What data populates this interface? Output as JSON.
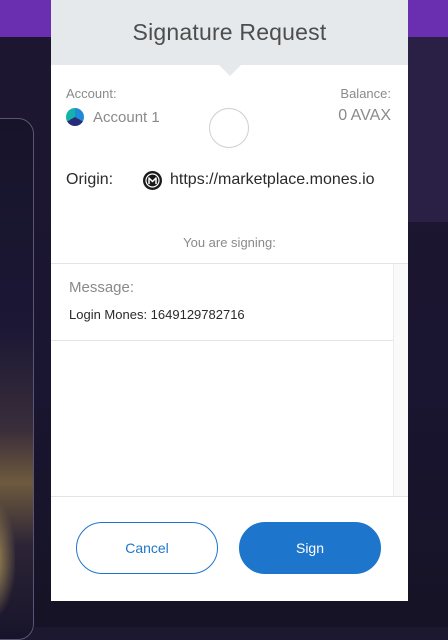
{
  "header": {
    "title": "Signature Request"
  },
  "account": {
    "label": "Account:",
    "name": "Account 1"
  },
  "balance": {
    "label": "Balance:",
    "value": "0 AVAX"
  },
  "origin": {
    "label": "Origin:",
    "url": "https://marketplace.mones.io",
    "favicon": "mones-logo-icon"
  },
  "signing": {
    "note": "You are signing:"
  },
  "message": {
    "label": "Message:",
    "value": "Login Mones: 1649129782716"
  },
  "actions": {
    "cancel_label": "Cancel",
    "sign_label": "Sign"
  },
  "colors": {
    "primary": "#1d76cc",
    "header_bg": "#e6e9ec",
    "page_bar": "#6a2fb0"
  }
}
